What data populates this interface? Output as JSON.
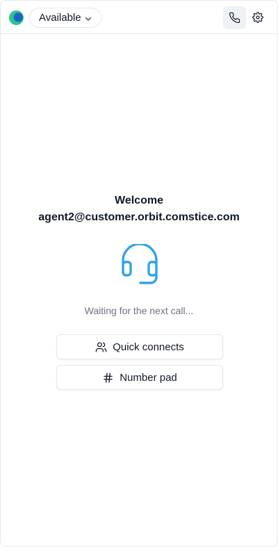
{
  "header": {
    "status": {
      "label": "Available",
      "options_visible": [
        "Available"
      ]
    },
    "icons": {
      "logo": "brand-logo-icon",
      "status_chevron": "chevron-down-icon",
      "phone": "phone-icon",
      "settings": "gear-icon"
    }
  },
  "main": {
    "welcome_title": "Welcome",
    "agent_email": "agent2@customer.orbit.comstice.com",
    "headset_icon": "headset-icon",
    "waiting_text": "Waiting for the next call...",
    "buttons": {
      "quick_connects": {
        "label": "Quick connects",
        "icon": "users-icon"
      },
      "number_pad": {
        "label": "Number pad",
        "icon": "hash-icon"
      }
    }
  },
  "colors": {
    "accent_blue": "#2fa4e7",
    "logo_green": "#2bc48a",
    "logo_blue": "#1d63c7",
    "border": "#e5e7eb",
    "muted_text": "#6b7280",
    "phone_button_bg": "#eef1f5"
  }
}
